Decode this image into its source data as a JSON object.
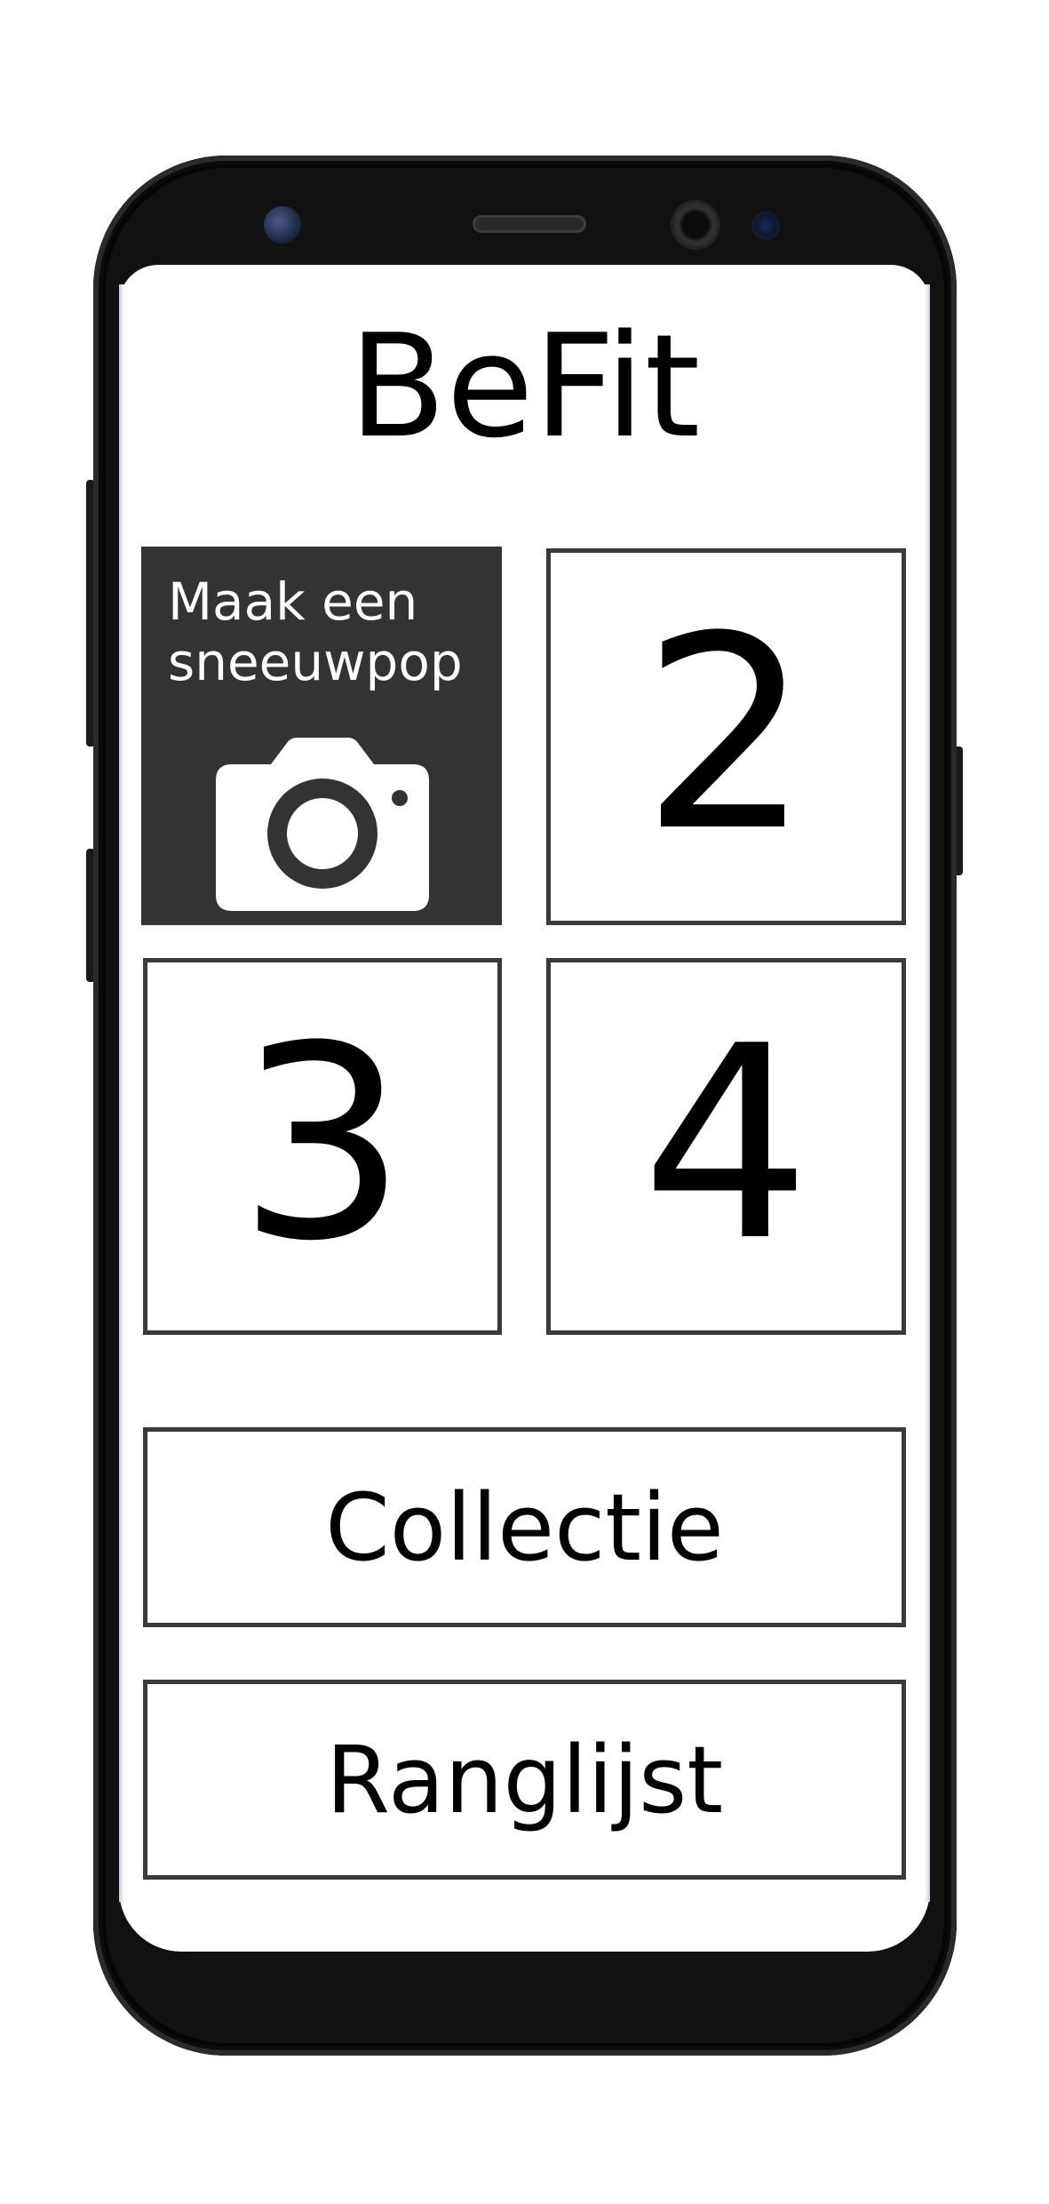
{
  "app": {
    "title": "BeFit"
  },
  "tiles": [
    {
      "label": "Maak een\nsneeuwpop",
      "icon": "camera-icon"
    },
    {
      "label": "2"
    },
    {
      "label": "3"
    },
    {
      "label": "4"
    }
  ],
  "buttons": {
    "collection_label": "Collectie",
    "leaderboard_label": "Ranglijst"
  },
  "colors": {
    "active_tile_bg": "#333333",
    "tile_border": "#3a3a3a",
    "text": "#000000",
    "active_tile_text": "#ffffff"
  }
}
